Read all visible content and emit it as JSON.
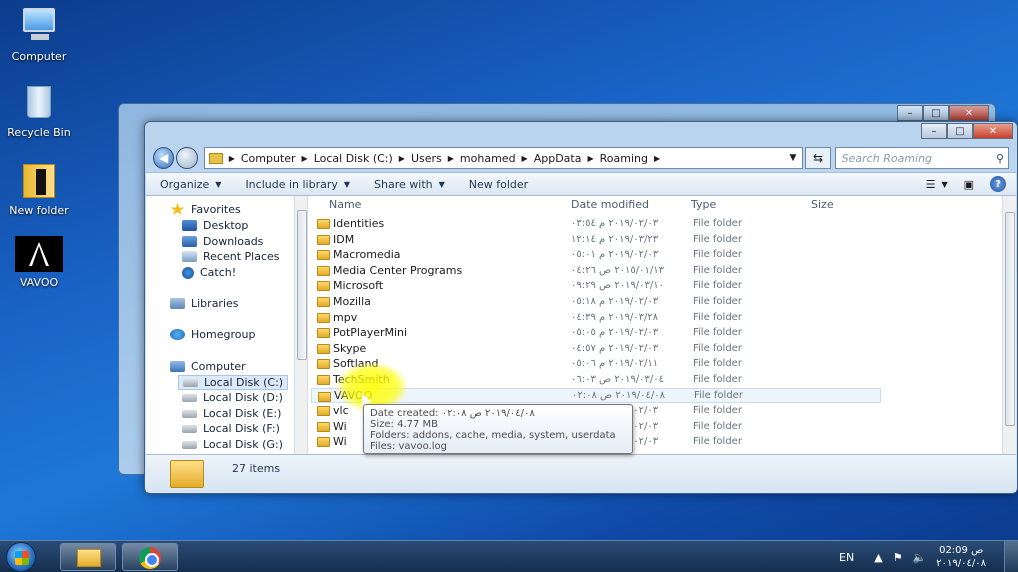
{
  "desktop": {
    "icons": [
      {
        "label": "Computer",
        "icon": "computer-icon"
      },
      {
        "label": "Recycle Bin",
        "icon": "recycle-bin-icon"
      },
      {
        "label": "New folder",
        "icon": "folder-icon"
      },
      {
        "label": "VAVOO",
        "icon": "vavoo-icon"
      }
    ]
  },
  "window": {
    "controls": {
      "minimize": "–",
      "maximize": "□",
      "close": "✕"
    },
    "address": {
      "crumbs": [
        "Computer",
        "Local Disk (C:)",
        "Users",
        "mohamed",
        "AppData",
        "Roaming"
      ]
    },
    "search": {
      "placeholder": "Search Roaming"
    },
    "toolbar": {
      "organize": "Organize",
      "include_in_library": "Include in library",
      "share_with": "Share with",
      "new_folder": "New folder"
    },
    "nav": {
      "favorites": "Favorites",
      "desktop": "Desktop",
      "downloads": "Downloads",
      "recent_places": "Recent Places",
      "catch": "Catch!",
      "libraries": "Libraries",
      "homegroup": "Homegroup",
      "computer": "Computer",
      "disks": [
        "Local Disk (C:)",
        "Local Disk (D:)",
        "Local Disk (E:)",
        "Local Disk (F:)",
        "Local Disk (G:)"
      ]
    },
    "columns": {
      "name": "Name",
      "date_modified": "Date modified",
      "type": "Type",
      "size": "Size"
    },
    "files": [
      {
        "name": "Identities",
        "date": "٢٠١٩/٠٢/٠٣ م ٠٣:٥٤",
        "type": "File folder"
      },
      {
        "name": "IDM",
        "date": "٢٠١٩/٠٣/٢٣ م ١٢:١٤",
        "type": "File folder"
      },
      {
        "name": "Macromedia",
        "date": "٢٠١٩/٠٢/٠٣ م ٠٥:٠١",
        "type": "File folder"
      },
      {
        "name": "Media Center Programs",
        "date": "٢٠١٥/٠١/١٣ ص ٠٤:٢٦",
        "type": "File folder"
      },
      {
        "name": "Microsoft",
        "date": "٢٠١٩/٠٣/١٠ ص ٠٩:٢٩",
        "type": "File folder"
      },
      {
        "name": "Mozilla",
        "date": "٢٠١٩/٠٢/٠٣ م ٠٥:١٨",
        "type": "File folder"
      },
      {
        "name": "mpv",
        "date": "٢٠١٩/٠٣/٢٨ م ٠٤:٣٩",
        "type": "File folder"
      },
      {
        "name": "PotPlayerMini",
        "date": "٢٠١٩/٠٢/٠٣ م ٠٥:٠٥",
        "type": "File folder"
      },
      {
        "name": "Skype",
        "date": "٢٠١٩/٠٢/٠٣ م ٠٤:٥٧",
        "type": "File folder"
      },
      {
        "name": "Softland",
        "date": "٢٠١٩/٠٢/١١ م ٠٥:٠٦",
        "type": "File folder"
      },
      {
        "name": "TechSmith",
        "date": "٢٠١٩/٠٣/٠٤ ص ٠٦:٠٣",
        "type": "File folder"
      },
      {
        "name": "VAVOO",
        "date": "٢٠١٩/٠٤/٠٨ ص ٠٢:٠٨",
        "type": "File folder"
      },
      {
        "name": "vlc",
        "date": "٢٠١٩/٠٢/٠٣ م ٠٤:٣٦",
        "type": "File folder"
      },
      {
        "name": "Wi",
        "date": "٢٠١٩/٠٢/٠٣ م ٠٣:٢٧",
        "type": "File folder"
      },
      {
        "name": "Wi",
        "date": "٢٠١٩/٠٢/٠٣ م ٠٣:١٨",
        "type": "File folder"
      }
    ],
    "tooltip": {
      "line1": "Date created: ٢٠١٩/٠٤/٠٨ ص ٠٢:٠٨",
      "line2": "Size: 4.77 MB",
      "line3": "Folders: addons, cache, media, system, userdata",
      "line4": "Files: vavoo.log"
    },
    "status": {
      "count": "27 items"
    }
  },
  "taskbar": {
    "lang": "EN",
    "time": "ص 02:09",
    "date": "٢٠١٩/٠٤/٠٨"
  }
}
